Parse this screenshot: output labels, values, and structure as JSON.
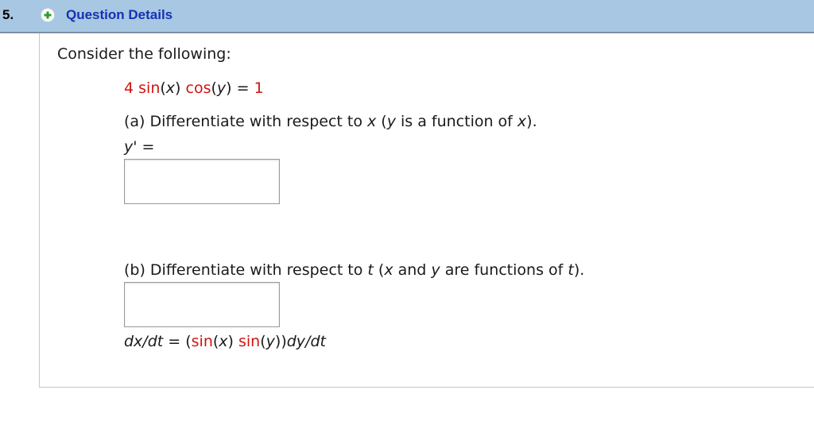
{
  "question": {
    "number": "5.",
    "title": "Question Details",
    "intro": "Consider the following:"
  },
  "equation": {
    "coef": "4 ",
    "f1": "sin",
    "arg1": "(",
    "var1": "x",
    "close1": ") ",
    "f2": "cos",
    "open2": "(",
    "var2": "y",
    "close2": ")",
    "equals": " = ",
    "rhs": "1"
  },
  "part_a": {
    "text1": "(a) Differentiate with respect to ",
    "var": "x",
    "text2": " (",
    "var2": "y",
    "text3": " is a function of ",
    "var3": "x",
    "text4": ").",
    "answer_label_var": "y'",
    "answer_label_eq": " ="
  },
  "part_b": {
    "text1": "(b) Differentiate with respect to ",
    "var": "t",
    "text2": " (",
    "var2": "x",
    "text3": " and ",
    "var3": "y",
    "text4": " are functions of ",
    "var4": "t",
    "text5": ").",
    "res_lhs": "dx/dt",
    "res_eq": " = (",
    "res_f1": "sin",
    "res_a1": "(",
    "res_v1": "x",
    "res_c1": ") ",
    "res_f2": "sin",
    "res_a2": "(",
    "res_v2": "y",
    "res_c2": "))",
    "res_tail": "dy/dt"
  },
  "answers": {
    "a_value": "",
    "b_value": ""
  },
  "colors": {
    "header_bg": "#a8c7e2",
    "title_link": "#1432b3",
    "function_red": "#d0150f",
    "plus_green": "#2e9b2e"
  },
  "icons": {
    "expand": "plus-circle-icon"
  }
}
